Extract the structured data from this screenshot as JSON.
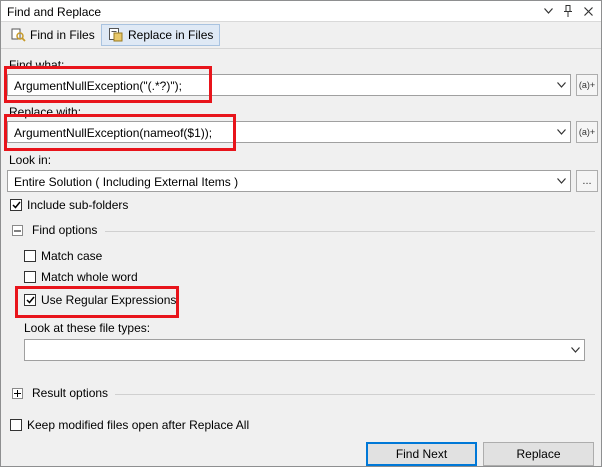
{
  "window": {
    "title": "Find and Replace",
    "icons": [
      "chevron-down-icon",
      "pin-icon",
      "close-icon"
    ]
  },
  "tabs": [
    {
      "label": "Find in Files",
      "selected": false
    },
    {
      "label": "Replace in Files",
      "selected": true
    }
  ],
  "find": {
    "label": "Find what:",
    "value": "ArgumentNullException(\"(.*?)\");",
    "regex_button": "(a)+"
  },
  "replace": {
    "label": "Replace with:",
    "value": "ArgumentNullException(nameof($1));",
    "regex_button": "(a)+"
  },
  "look_in": {
    "label": "Look in:",
    "value": "Entire Solution ( Including External Items )",
    "browse_button": "..."
  },
  "include_subfolders": {
    "label": "Include sub-folders",
    "checked": true
  },
  "find_options": {
    "header": "Find options",
    "expanded": true,
    "match_case": {
      "label": "Match case",
      "checked": false
    },
    "match_whole_word": {
      "label": "Match whole word",
      "checked": false
    },
    "use_regex": {
      "label": "Use Regular Expressions",
      "checked": true
    },
    "file_types_label": "Look at these file types:",
    "file_types_value": ""
  },
  "result_options": {
    "header": "Result options",
    "expanded": false
  },
  "keep_modified": {
    "label": "Keep modified files open after Replace All",
    "checked": false
  },
  "buttons": {
    "find_next": "Find Next",
    "replace": "Replace"
  },
  "colors": {
    "highlight": "#e8141b",
    "tab_selected_bg": "#dfe9f5",
    "default_button_border": "#0078d7"
  }
}
